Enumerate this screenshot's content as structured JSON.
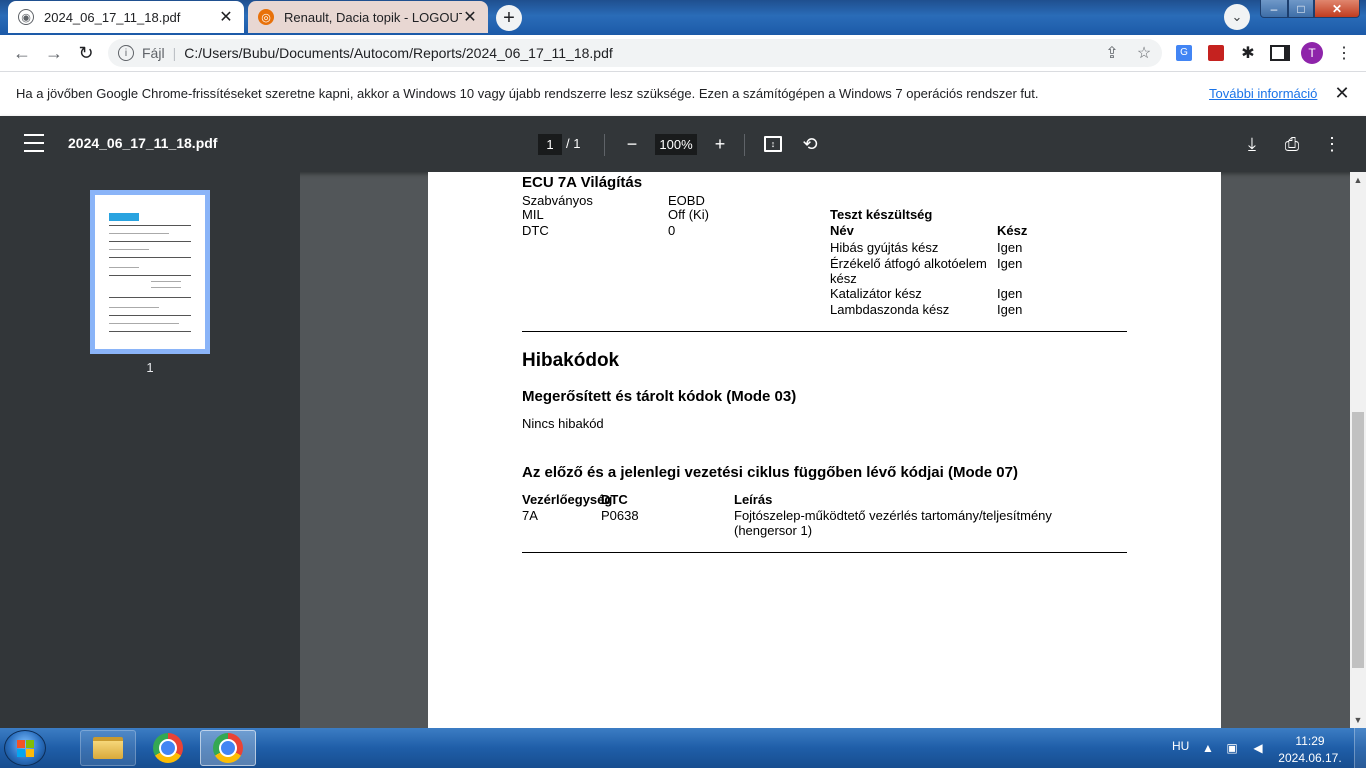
{
  "tabs": [
    {
      "title": "2024_06_17_11_18.pdf",
      "favicon": "globe-icon",
      "active": true
    },
    {
      "title": "Renault, Dacia topik - LOGOUT.hu",
      "favicon": "logout-icon",
      "active": false
    }
  ],
  "window": {
    "new_tab": "+",
    "minimize": "–",
    "maximize": "□",
    "close": "✕"
  },
  "toolbar": {
    "scheme": "Fájl",
    "url": "C:/Users/Bubu/Documents/Autocom/Reports/2024_06_17_11_18.pdf",
    "profile_initial": "T"
  },
  "infobar": {
    "text": "Ha a jövőben Google Chrome-frissítéseket szeretne kapni, akkor a Windows 10 vagy újabb rendszerre lesz szüksége. Ezen a számítógépen a Windows 7 operációs rendszer fut.",
    "link": "További információ"
  },
  "pdf_viewer": {
    "title": "2024_06_17_11_18.pdf",
    "page_current": "1",
    "page_total": "/ 1",
    "zoom": "100%",
    "thumbnail_label": "1"
  },
  "document": {
    "ecu_heading": "ECU 7A Világítás",
    "info_rows": [
      {
        "label": "Szabványos",
        "value": "EOBD"
      },
      {
        "label": "MIL",
        "value": "Off (Ki)"
      },
      {
        "label": "DTC",
        "value": "0"
      }
    ],
    "readiness": {
      "heading": "Teszt készültség",
      "col_name": "Név",
      "col_ready": "Kész",
      "rows": [
        {
          "name": "Hibás gyújtás kész",
          "ready": "Igen"
        },
        {
          "name": "Érzékelő átfogó alkotóelem",
          "name2": "kész",
          "ready": "Igen"
        },
        {
          "name": "Katalizátor kész",
          "ready": "Igen"
        },
        {
          "name": "Lambdaszonda kész",
          "ready": "Igen"
        }
      ]
    },
    "fault_heading": "Hibakódok",
    "confirmed_heading": "Megerősített és tárolt kódok (Mode 03)",
    "confirmed_text": "Nincs hibakód",
    "pending_heading": "Az előző és a jelenlegi vezetési ciklus függőben lévő kódjai (Mode 07)",
    "pending_table": {
      "col_ecu": "Vezérlőegység",
      "col_dtc": "DTC",
      "col_desc": "Leírás",
      "rows": [
        {
          "ecu": "7A",
          "dtc": "P0638",
          "desc": "Fojtószelep-működtető vezérlés tartomány/teljesítmény",
          "desc2": "(hengersor 1)"
        }
      ]
    }
  },
  "taskbar": {
    "language": "HU",
    "time": "11:29",
    "date": "2024.06.17."
  },
  "colors": {
    "pdf_toolbar": "#323639",
    "viewer_bg": "#525659",
    "link": "#1a73e8",
    "thumbnail_border": "#8ab4f8"
  }
}
